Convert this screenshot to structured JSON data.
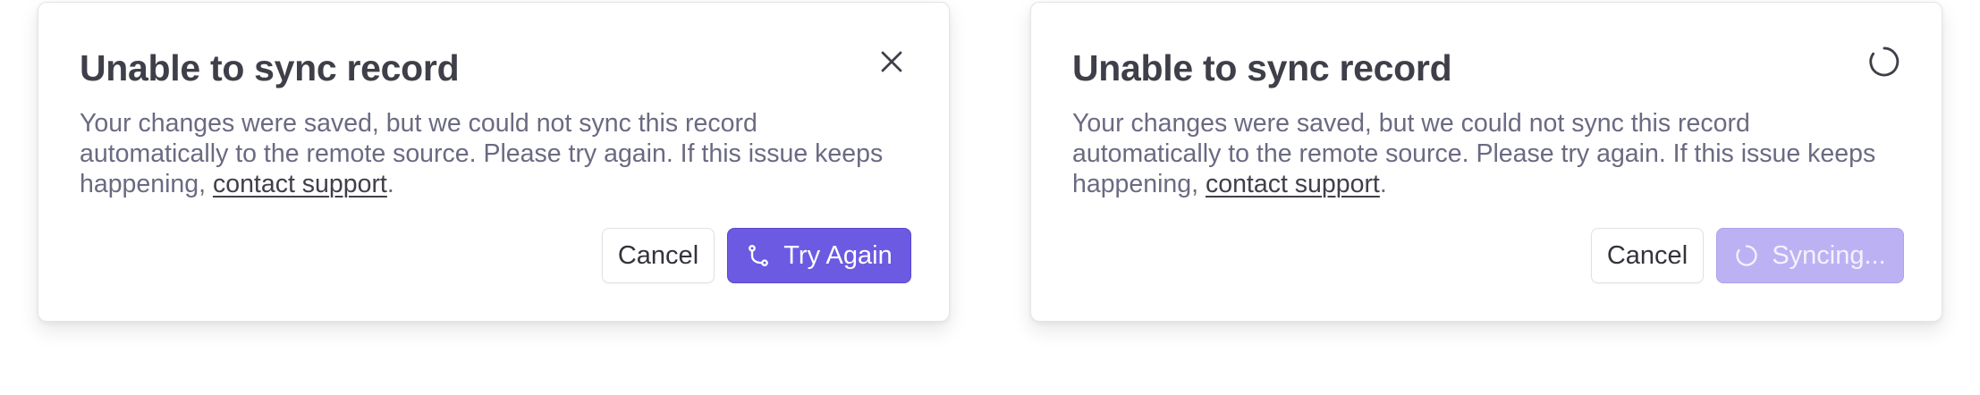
{
  "dialogs": [
    {
      "title": "Unable to sync record",
      "message_prefix": "Your changes were saved, but we could not sync this record automatically to the remote source. Please try again. If this issue keeps happening, ",
      "link_label": "contact support",
      "message_suffix": ".",
      "header_icon": "close-icon",
      "cancel_label": "Cancel",
      "primary_label": "Try Again",
      "primary_icon": "git-branch-icon",
      "primary_state": "enabled"
    },
    {
      "title": "Unable to sync record",
      "message_prefix": "Your changes were saved, but we could not sync this record automatically to the remote source. Please try again. If this issue keeps happening, ",
      "link_label": "contact support",
      "message_suffix": ".",
      "header_icon": "loading-spinner-icon",
      "cancel_label": "Cancel",
      "primary_label": "Syncing...",
      "primary_icon": "loading-spinner-icon",
      "primary_state": "disabled-loading"
    }
  ],
  "colors": {
    "accent": "#6d5ae2",
    "accent_disabled": "#bcb2f3",
    "title_text": "#3f3f4a",
    "body_text": "#6a6a82"
  }
}
